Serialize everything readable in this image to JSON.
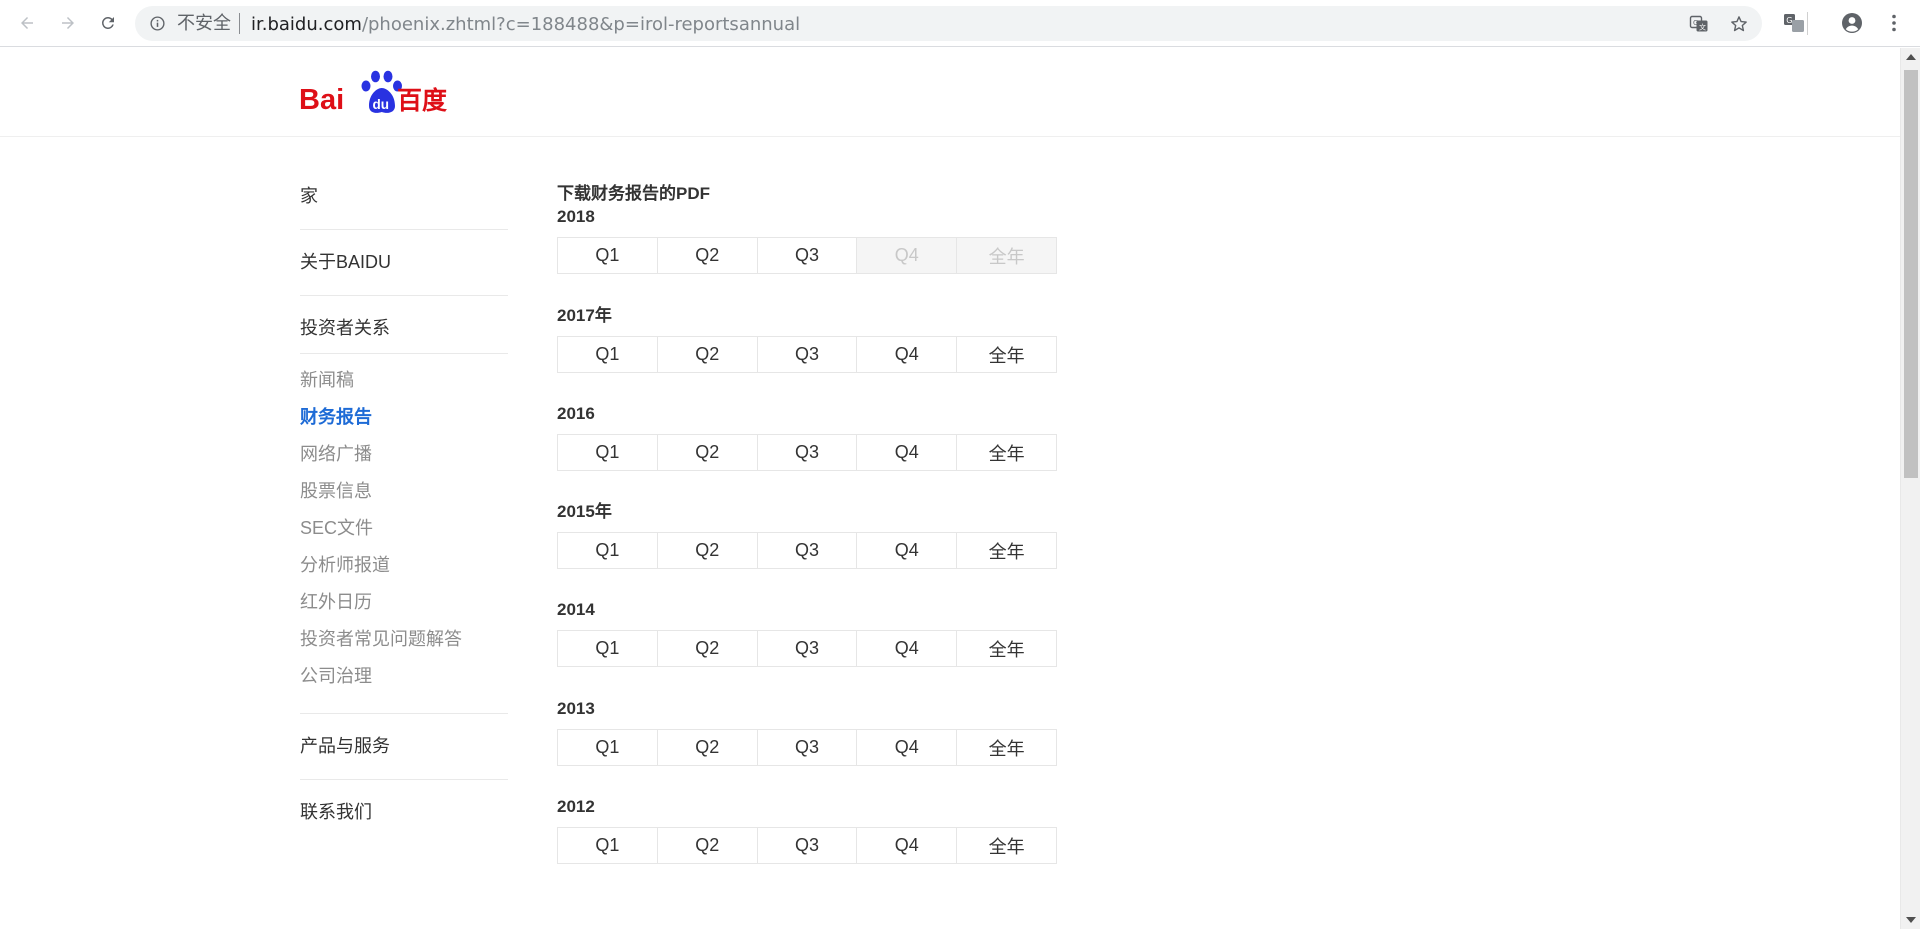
{
  "browser": {
    "security_label": "不安全",
    "url_host": "ir.baidu.com",
    "url_path": "/phoenix.zhtml?c=188488&p=irol-reportsannual"
  },
  "brand": {
    "logo_text_left": "Bai",
    "logo_text_du": "du",
    "logo_text_cn": "百度",
    "red": "#de0f17",
    "blue": "#2932e1"
  },
  "sidebar": {
    "top_items": [
      {
        "label": "家"
      },
      {
        "label": "关于BAIDU"
      },
      {
        "label": "投资者关系"
      }
    ],
    "sub_items": [
      {
        "label": "新闻稿",
        "active": false
      },
      {
        "label": "财务报告",
        "active": true
      },
      {
        "label": "网络广播",
        "active": false
      },
      {
        "label": "股票信息",
        "active": false
      },
      {
        "label": "SEC文件",
        "active": false
      },
      {
        "label": "分析师报道",
        "active": false
      },
      {
        "label": "红外日历",
        "active": false
      },
      {
        "label": "投资者常见问题解答",
        "active": false
      },
      {
        "label": "公司治理",
        "active": false
      }
    ],
    "bottom_items": [
      {
        "label": "产品与服务"
      },
      {
        "label": "联系我们"
      }
    ],
    "active_color": "#1e6bd6"
  },
  "content": {
    "title": "下载财务报告的PDF",
    "years": [
      {
        "year": "2018",
        "periods": [
          {
            "label": "Q1",
            "enabled": true
          },
          {
            "label": "Q2",
            "enabled": true
          },
          {
            "label": "Q3",
            "enabled": true
          },
          {
            "label": "Q4",
            "enabled": false
          },
          {
            "label": "全年",
            "enabled": false
          }
        ]
      },
      {
        "year": "2017年",
        "periods": [
          {
            "label": "Q1",
            "enabled": true
          },
          {
            "label": "Q2",
            "enabled": true
          },
          {
            "label": "Q3",
            "enabled": true
          },
          {
            "label": "Q4",
            "enabled": true
          },
          {
            "label": "全年",
            "enabled": true
          }
        ]
      },
      {
        "year": "2016",
        "periods": [
          {
            "label": "Q1",
            "enabled": true
          },
          {
            "label": "Q2",
            "enabled": true
          },
          {
            "label": "Q3",
            "enabled": true
          },
          {
            "label": "Q4",
            "enabled": true
          },
          {
            "label": "全年",
            "enabled": true
          }
        ]
      },
      {
        "year": "2015年",
        "periods": [
          {
            "label": "Q1",
            "enabled": true
          },
          {
            "label": "Q2",
            "enabled": true
          },
          {
            "label": "Q3",
            "enabled": true
          },
          {
            "label": "Q4",
            "enabled": true
          },
          {
            "label": "全年",
            "enabled": true
          }
        ]
      },
      {
        "year": "2014",
        "periods": [
          {
            "label": "Q1",
            "enabled": true
          },
          {
            "label": "Q2",
            "enabled": true
          },
          {
            "label": "Q3",
            "enabled": true
          },
          {
            "label": "Q4",
            "enabled": true
          },
          {
            "label": "全年",
            "enabled": true
          }
        ]
      },
      {
        "year": "2013",
        "periods": [
          {
            "label": "Q1",
            "enabled": true
          },
          {
            "label": "Q2",
            "enabled": true
          },
          {
            "label": "Q3",
            "enabled": true
          },
          {
            "label": "Q4",
            "enabled": true
          },
          {
            "label": "全年",
            "enabled": true
          }
        ]
      },
      {
        "year": "2012",
        "periods": [
          {
            "label": "Q1",
            "enabled": true
          },
          {
            "label": "Q2",
            "enabled": true
          },
          {
            "label": "Q3",
            "enabled": true
          },
          {
            "label": "Q4",
            "enabled": true
          },
          {
            "label": "全年",
            "enabled": true
          }
        ]
      }
    ]
  }
}
